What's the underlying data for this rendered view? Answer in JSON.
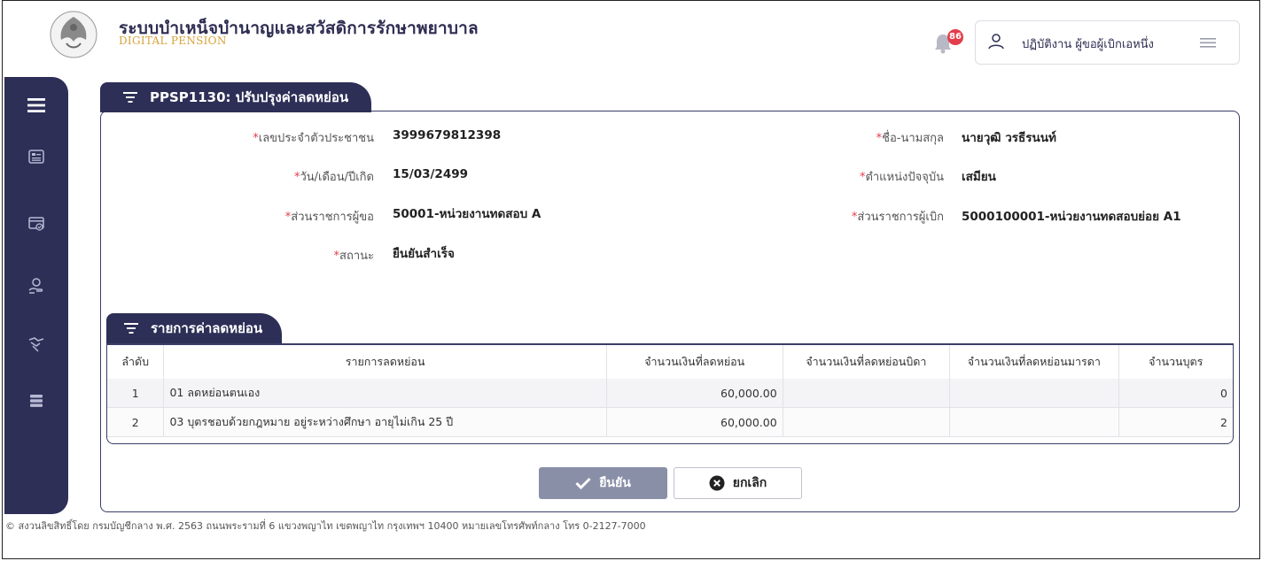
{
  "header": {
    "title": "ระบบบำเหน็จบำนาญและสวัสดิการรักษาพยาบาล",
    "subtitle": "DIGITAL PENSION",
    "notification_count": "86",
    "user_name": "ปฏิบัติงาน ผู้ขอผู้เบิกเอหนึ่ง"
  },
  "sidebar": {
    "items": [
      {
        "icon": "hamburger-icon"
      },
      {
        "icon": "id-card-icon"
      },
      {
        "icon": "check-card-icon"
      },
      {
        "icon": "care-hand-icon"
      },
      {
        "icon": "handshake-icon"
      },
      {
        "icon": "stack-icon"
      }
    ]
  },
  "page": {
    "title": "PPSP1130: ปรับปรุงค่าลดหย่อน"
  },
  "form": {
    "citizen_id_label": "เลขประจำตัวประชาชน",
    "citizen_id_value": "3999679812398",
    "name_label": "ชื่อ-นามสกุล",
    "name_value": "นายวุฒิ วรธีรนนท์",
    "dob_label": "วัน/เดือน/ปีเกิด",
    "dob_value": "15/03/2499",
    "position_label": "ตำแหน่งปัจจุบัน",
    "position_value": "เสมียน",
    "agency_req_label": "ส่วนราชการผู้ขอ",
    "agency_req_value": "50001-หน่วยงานทดสอบ A",
    "agency_pay_label": "ส่วนราชการผู้เบิก",
    "agency_pay_value": "5000100001-หน่วยงานทดสอบย่อย A1",
    "status_label": "สถานะ",
    "status_value": "ยืนยันสำเร็จ",
    "required_mark": "*"
  },
  "deduction_section": {
    "title": "รายการค่าลดหย่อน",
    "columns": [
      "ลำดับ",
      "รายการลดหย่อน",
      "จำนวนเงินที่ลดหย่อน",
      "จำนวนเงินที่ลดหย่อนบิดา",
      "จำนวนเงินที่ลดหย่อนมารดา",
      "จำนวนบุตร"
    ],
    "rows": [
      {
        "no": "1",
        "item": "01 ลดหย่อนตนเอง",
        "amount": "60,000.00",
        "father": "",
        "mother": "",
        "children": "0"
      },
      {
        "no": "2",
        "item": "03 บุตรชอบด้วยกฎหมาย อยู่ระหว่างศึกษา อายุไม่เกิน 25 ปี",
        "amount": "60,000.00",
        "father": "",
        "mother": "",
        "children": "2"
      }
    ]
  },
  "actions": {
    "confirm_label": "ยืนยัน",
    "cancel_label": "ยกเลิก"
  },
  "footer": {
    "text": "© สงวนลิขสิทธิ์โดย กรมบัญชีกลาง พ.ศ. 2563 ถนนพระรามที่ 6 แขวงพญาไท เขตพญาไท กรุงเทพฯ 10400 หมายเลขโทรศัพท์กลาง โทร 0-2127-7000"
  },
  "colors": {
    "primary": "#2d2f57",
    "accent": "#d8a23b",
    "required": "#e33c4a",
    "confirm_button": "#8a8fa8"
  }
}
